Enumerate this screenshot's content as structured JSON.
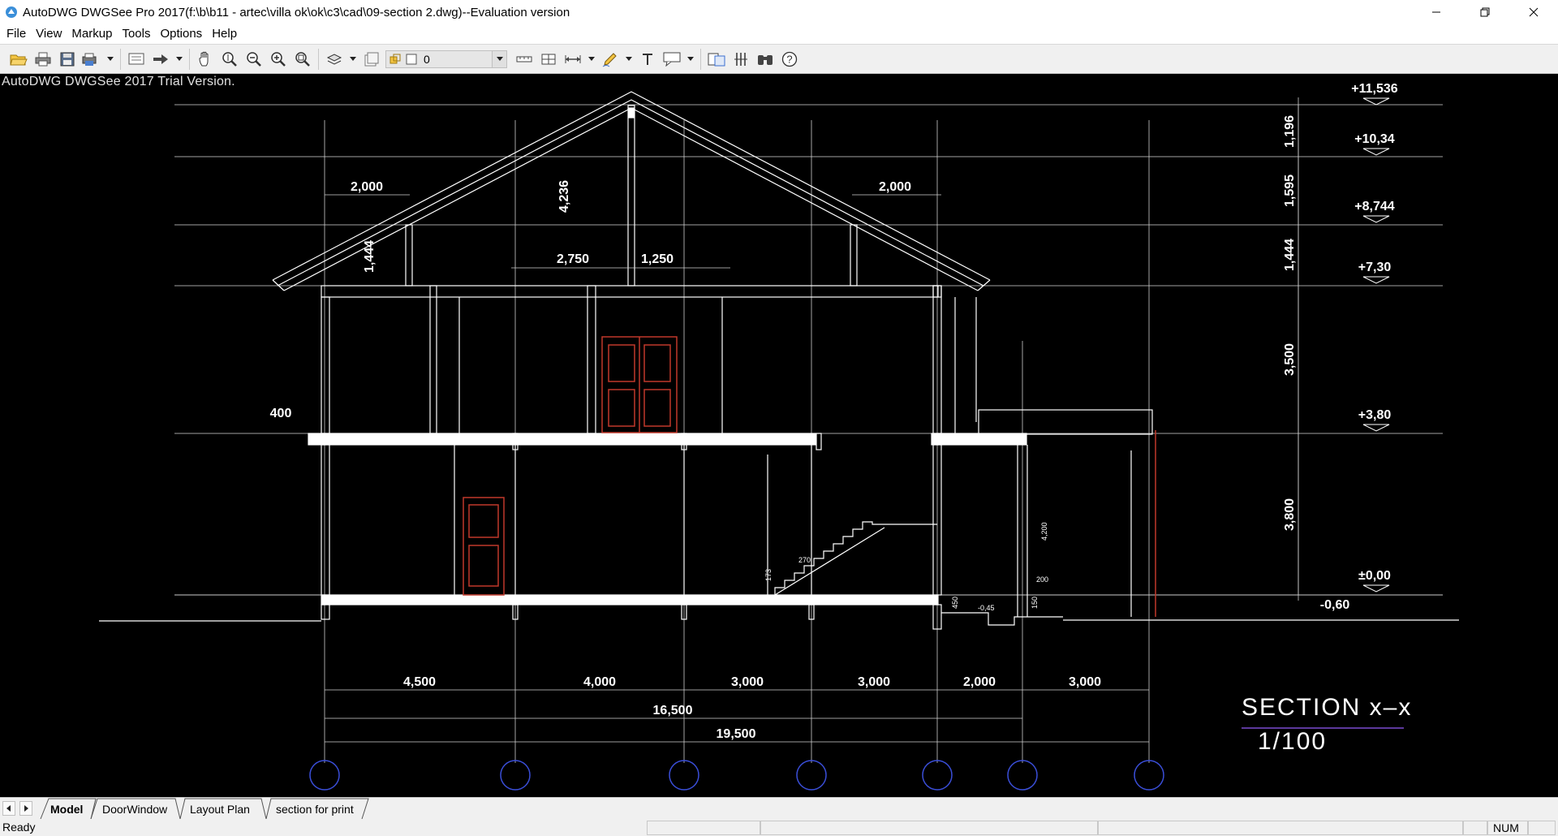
{
  "window": {
    "title": "AutoDWG DWGSee Pro 2017(f:\\b\\b11 - artec\\villa ok\\ok\\c3\\cad\\09-section 2.dwg)--Evaluation version",
    "controls": [
      "minimize-icon",
      "restore-icon",
      "close-icon"
    ]
  },
  "menu": {
    "items": [
      "File",
      "View",
      "Markup",
      "Tools",
      "Options",
      "Help"
    ]
  },
  "toolbar": {
    "buttons": [
      "open-folder-icon",
      "print-icon",
      "save-icon",
      "batch-print-icon",
      "print-preview-icon",
      "send-icon",
      "pan-hand-icon",
      "zoom-realtime-icon",
      "zoom-out-icon",
      "zoom-in-icon",
      "zoom-window-icon",
      "layers-icon",
      "layout-icon",
      "measure-distance-icon",
      "measure-area-icon",
      "dimension-icon",
      "pen-markup-icon",
      "text-icon",
      "callout-icon",
      "compare-icon",
      "hatch-icon",
      "find-icon",
      "help-icon"
    ],
    "layer_value": "0"
  },
  "canvas": {
    "trial_notice": "AutoDWG DWGSee 2017 Trial Version.",
    "background": "#000000",
    "line_color": "#ffffff",
    "door_color": "#c0392b",
    "grid_bubble_color": "#3a4ed8",
    "title_underline_color": "#7a4bd0"
  },
  "drawing": {
    "section_title": "SECTION  x–x",
    "scale": "1/100",
    "levels": [
      "+11,536",
      "+10,34",
      "+8,744",
      "+7,30",
      "+3,80",
      "±0,00",
      "-0,60"
    ],
    "vertical_dims": [
      "1,196",
      "1,595",
      "1,444",
      "3,500",
      "3,800"
    ],
    "top_dims": [
      "2,000",
      "4,236",
      "2,000",
      "1,444",
      "2,750",
      "1,250"
    ],
    "side_dim": "400",
    "bottom_dims": [
      "4,500",
      "4,000",
      "3,000",
      "3,000",
      "2,000",
      "3,000"
    ],
    "total_16500": "16,500",
    "total_19500": "19,500",
    "small_labels": [
      "270",
      "173",
      "4,200",
      "200",
      "150",
      "450",
      "-0,45"
    ]
  },
  "tabs": {
    "items": [
      "Model",
      "DoorWindow",
      "Layout Plan",
      "section for print"
    ],
    "active": "Model"
  },
  "status": {
    "text": "Ready",
    "num": "NUM"
  }
}
